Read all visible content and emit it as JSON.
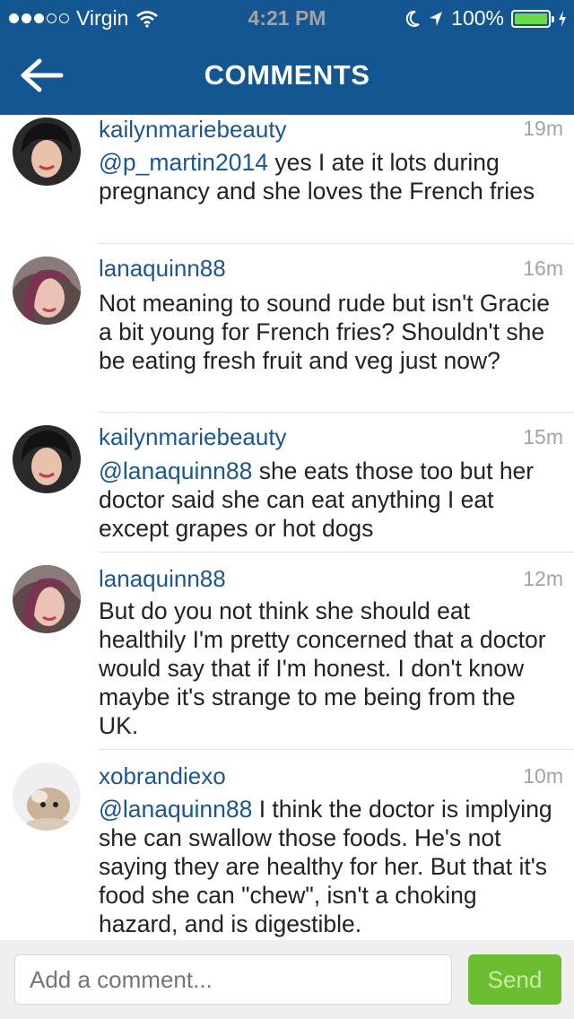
{
  "status_bar": {
    "carrier": "Virgin",
    "time": "4:21 PM",
    "battery": "100%",
    "signal_bars_filled": 3,
    "signal_bars_total": 5
  },
  "nav": {
    "title": "COMMENTS",
    "back_icon": "back-arrow-icon"
  },
  "comments": [
    {
      "username": "kailynmariebeauty",
      "time": "19m",
      "mention": "@p_martin2014",
      "text": " yes I ate it lots during pregnancy and she loves the French fries"
    },
    {
      "username": "lanaquinn88",
      "time": "16m",
      "mention": "",
      "text": "Not meaning to sound rude but isn't Gracie a bit young for French fries? Shouldn't she be eating fresh fruit and veg just now?"
    },
    {
      "username": "kailynmariebeauty",
      "time": "15m",
      "mention": "@lanaquinn88",
      "text": " she eats those too but her doctor said she can eat anything I eat except grapes or hot dogs"
    },
    {
      "username": "lanaquinn88",
      "time": "12m",
      "mention": "",
      "text": "But do you not think she should eat healthily I'm pretty concerned that a doctor would say that if I'm honest. I don't know maybe it's strange to me being from the UK."
    },
    {
      "username": "xobrandiexo",
      "time": "10m",
      "mention": "@lanaquinn88",
      "text": " I think the doctor is implying she can swallow those foods. He's not saying they are healthy for her. But that it's food she can \"chew\", isn't a choking hazard, and is digestible."
    }
  ],
  "composer": {
    "placeholder": "Add a comment...",
    "send_label": "Send"
  },
  "colors": {
    "nav_blue": "#135691",
    "link_blue": "#1b5691",
    "send_green": "#6dbd33"
  }
}
